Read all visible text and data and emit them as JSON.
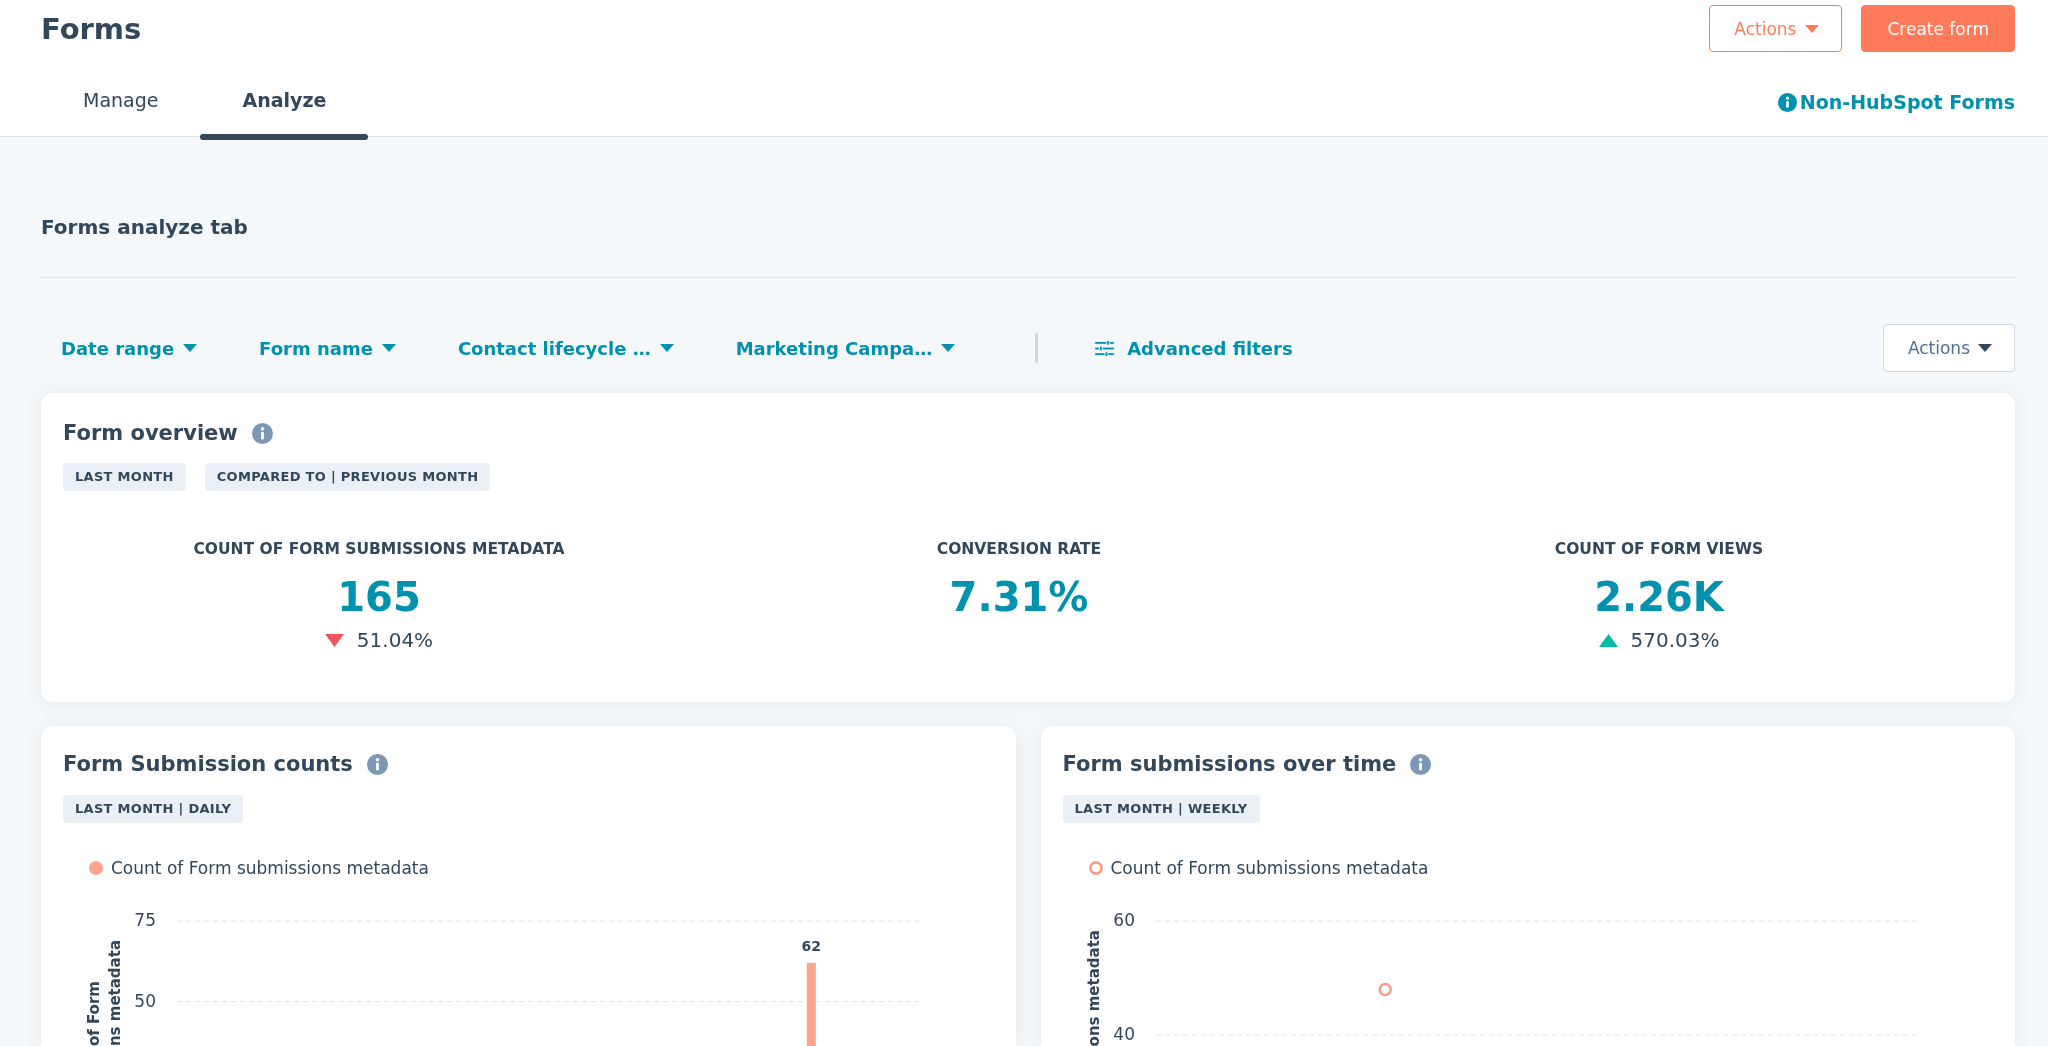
{
  "header": {
    "title": "Forms",
    "buttons": [
      {
        "label": "Actions",
        "kind": "dropdown"
      },
      {
        "label": "Create form",
        "kind": "primary"
      }
    ],
    "tabs": [
      {
        "label": "Manage",
        "selected": false
      },
      {
        "label": "Analyze",
        "selected": true
      }
    ],
    "link": {
      "label": "Non-HubSpot Forms"
    }
  },
  "section_title": "Forms analyze tab",
  "filter_bar": {
    "filters": [
      {
        "label": "Date range"
      },
      {
        "label": "Form name"
      },
      {
        "label": "Contact lifecycle …"
      },
      {
        "label": "Marketing Campa…"
      }
    ],
    "advanced_filters": {
      "label": "Advanced filters"
    },
    "actions": {
      "label": "Actions"
    }
  },
  "overview": {
    "title": "Form overview",
    "tags": [
      "LAST MONTH",
      "COMPARED TO | PREVIOUS MONTH"
    ],
    "stats": [
      {
        "label": "COUNT OF FORM SUBMISSIONS METADATA",
        "value": "165",
        "change": "51.04%",
        "increase": false
      },
      {
        "label": "CONVERSION RATE",
        "value": "7.31%"
      },
      {
        "label": "COUNT OF FORM VIEWS",
        "value": "2.26K",
        "change": "570.03%",
        "increase": true
      }
    ]
  },
  "report_cards": [
    {
      "title": "Form Submission counts",
      "tag": "LAST MONTH | DAILY",
      "chart_data": {
        "type": "bar",
        "ylabel": "of Form\nns metadata",
        "ylim": [
          36.2,
          75
        ],
        "yticks": [
          50,
          75
        ],
        "data_labels": true,
        "series": [
          {
            "name": "Count of Form submissions metadata",
            "color": "#fca58c",
            "values": [
              null,
              null,
              null,
              null,
              null,
              null,
              null,
              null,
              null,
              null,
              null,
              null,
              null,
              null,
              null,
              null,
              null,
              null,
              null,
              null,
              null,
              null,
              null,
              null,
              null,
              null,
              62,
              null,
              null,
              null,
              null
            ]
          }
        ]
      }
    },
    {
      "title": "Form submissions over time",
      "tag": "LAST MONTH | WEEKLY",
      "chart_data": {
        "type": "line",
        "ylabel": "ons metadata",
        "ylim": [
          40,
          60
        ],
        "yticks": [
          40,
          60
        ],
        "series": [
          {
            "name": "Count of Form submissions metadata",
            "color": "#f59d85",
            "marker": "circle",
            "values": [
              null,
              48,
              null,
              null,
              null
            ]
          }
        ]
      }
    }
  ]
}
